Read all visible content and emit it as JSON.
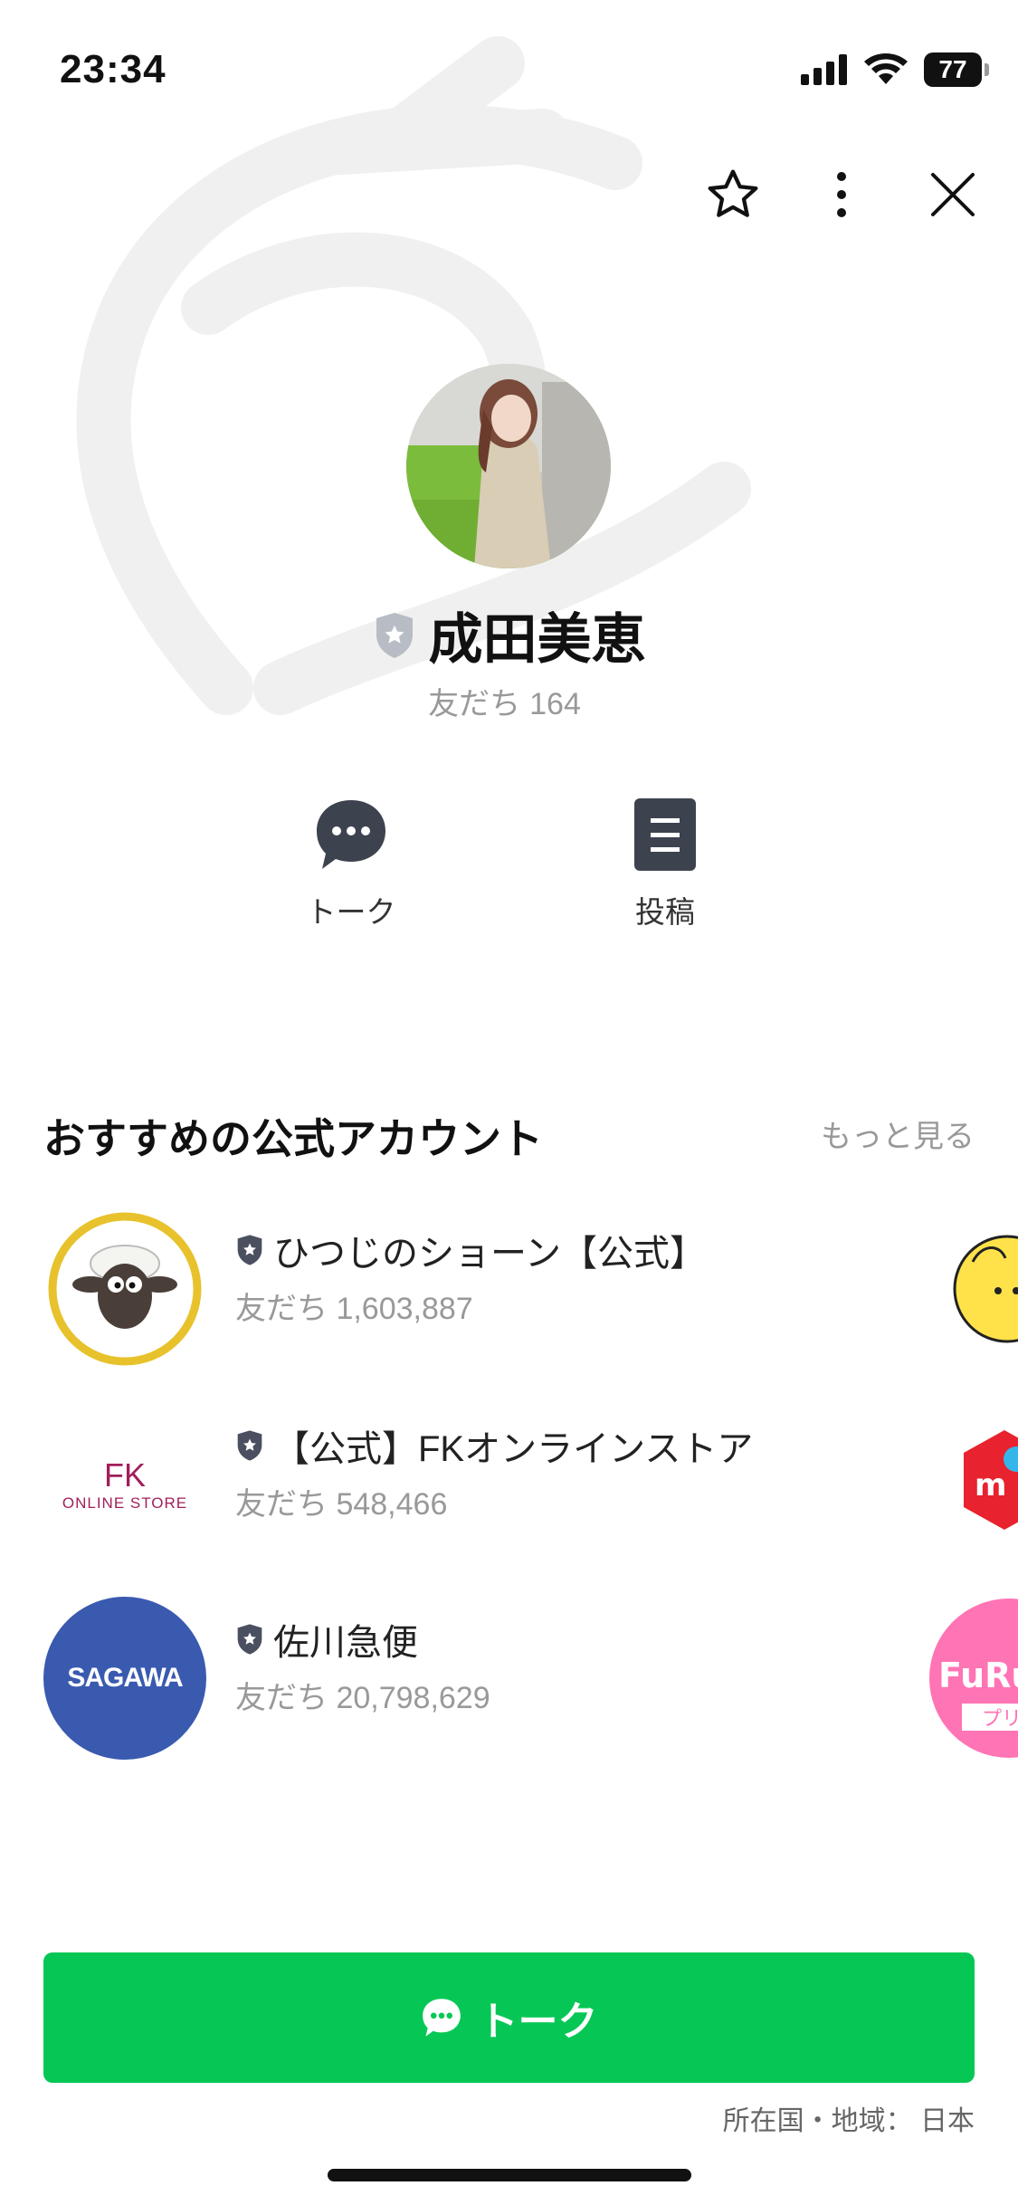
{
  "status": {
    "time": "23:34",
    "battery": "77"
  },
  "profile": {
    "name": "成田美恵",
    "friends_label": "友だち",
    "friends_count": "164"
  },
  "actions": {
    "talk": "トーク",
    "posts": "投稿"
  },
  "recommended": {
    "title": "おすすめの公式アカウント",
    "more": "もっと見る",
    "items": [
      {
        "name": "ひつじのショーン【公式】",
        "friends_label": "友だち",
        "friends": "1,603,887"
      },
      {
        "name": "【公式】FKオンラインストア",
        "friends_label": "友だち",
        "friends": "548,466",
        "logo_text": "FK",
        "logo_sub": "ONLINE STORE"
      },
      {
        "name": "佐川急便",
        "friends_label": "友だち",
        "friends": "20,798,629",
        "logo_text": "SAGAWA"
      }
    ],
    "peek_text": [
      "FuRu",
      "プリ"
    ]
  },
  "bottom": {
    "talk_button": "トーク",
    "region_label": "所在国・地域：",
    "region_value": "日本"
  },
  "colors": {
    "accent": "#06c755",
    "badge": "#4a5060",
    "sagawa": "#3a5ab0",
    "fk": "#a21e5a"
  },
  "icons": [
    "star-icon",
    "more-vertical-icon",
    "close-icon",
    "chat-bubble-icon",
    "document-icon",
    "shield-badge-icon"
  ]
}
